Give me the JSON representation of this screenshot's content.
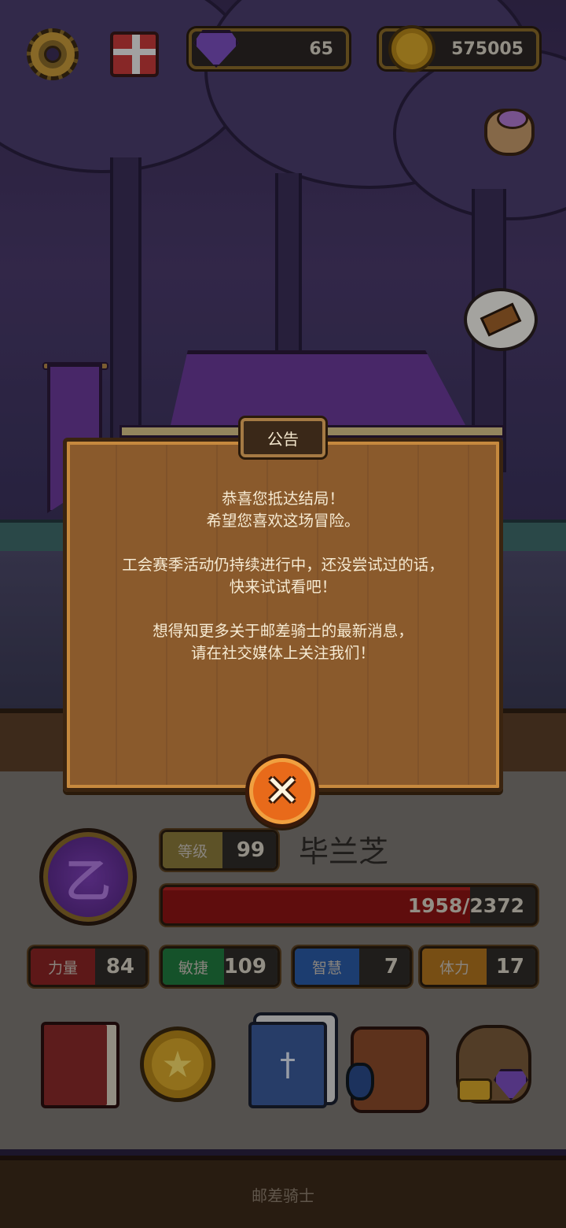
{
  "hud": {
    "gems": "65",
    "coins": "575005"
  },
  "announcement": {
    "title": "公告",
    "paragraphs": [
      [
        "恭喜您抵达结局！",
        "希望您喜欢这场冒险。"
      ],
      [
        "工会赛季活动仍持续进行中，还没尝试过的话，",
        "快来试试看吧！"
      ],
      [
        "想得知更多关于邮差骑士的最新消息，",
        "请在社交媒体上关注我们！"
      ]
    ],
    "close_icon": "close-x-icon"
  },
  "character": {
    "emblem_glyph": "乙",
    "level_label": "等级",
    "level_value": "99",
    "name": "毕兰芝",
    "hp_text": "1958/2372",
    "hp_current": 1958,
    "hp_max": 2372,
    "attributes": [
      {
        "label": "力量",
        "value": "84",
        "color": "#8a2424"
      },
      {
        "label": "敏捷",
        "value": "109",
        "color": "#1f7a3e"
      },
      {
        "label": "智慧",
        "value": "7",
        "color": "#2a5aa6"
      },
      {
        "label": "体力",
        "value": "17",
        "color": "#b0741e"
      }
    ]
  },
  "items": [
    "book-icon",
    "coin-icon",
    "cards-icon",
    "satchel-icon",
    "loot-bag-icon"
  ],
  "footer": {
    "label": "邮差骑士"
  }
}
